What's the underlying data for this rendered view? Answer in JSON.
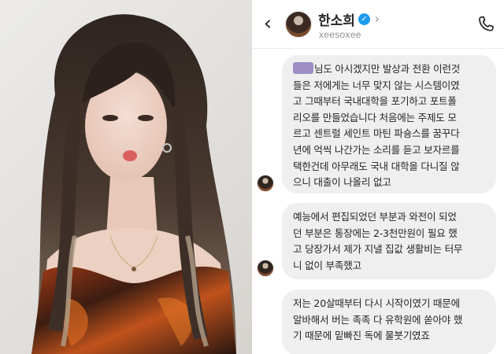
{
  "contact": {
    "name": "한소희",
    "handle": "xeesoxee",
    "verified": true
  },
  "header_icons": [
    "back-arrow-icon",
    "verified-badge-icon",
    "chevron-right-icon",
    "phone-icon"
  ],
  "messages": [
    {
      "sender": "contact",
      "redacted_prefix": true,
      "text": "님도 아시겠지만 발상과 전환 이런것\n들은 저에게는 너무 맞지 않는 시스템이였\n고 그때부터 국내대학을 포기하고 포트폴\n리오를 만들었습니다 처음에는 주제도 모\n르고 센트럴 세인트 마틴 파숑스를 꿈꾸다\n년에 억씩 나간가는 소리를 듣고 보자르를\n택한건데 아무래도 국내 대학을 다니질 않\n으니 대출이 나올리 없고"
    },
    {
      "sender": "contact",
      "redacted_prefix": false,
      "text": "예능에서 편집되었던 부분과 와전이 되었\n던 부분은 통장에는 2-3천만원이 필요 했\n고 당장가서 제가 지낼 집값 생활비는 터무\n니 없이 부족했고"
    },
    {
      "sender": "contact",
      "redacted_prefix": false,
      "text": "저는 20살때부터 다시 시작이였기 때문에\n알바해서 버는 족족 다 유학원에 쏟아야 했\n기 때문에 밑빠진 독에 물붓기였죠"
    }
  ],
  "colors": {
    "bubble_bg": "#efefef",
    "text": "#262626",
    "secondary_text": "#8e8e8e",
    "verified": "#1d9bf0",
    "redaction": "#9d8fc4"
  }
}
